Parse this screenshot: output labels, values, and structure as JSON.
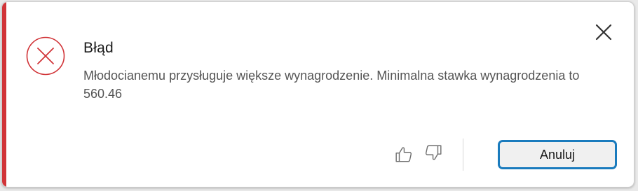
{
  "dialog": {
    "title": "Błąd",
    "message": "Młodocianemu przysługuje większe wynagrodzenie. Minimalna stawka wynagrodzenia to 560.46",
    "cancel_label": "Anuluj",
    "icons": {
      "status": "error-circle-x-icon",
      "close": "close-icon",
      "like": "thumbs-up-icon",
      "dislike": "thumbs-down-icon"
    },
    "colors": {
      "accent": "#d13438",
      "button_border": "#1a7bbd"
    }
  }
}
